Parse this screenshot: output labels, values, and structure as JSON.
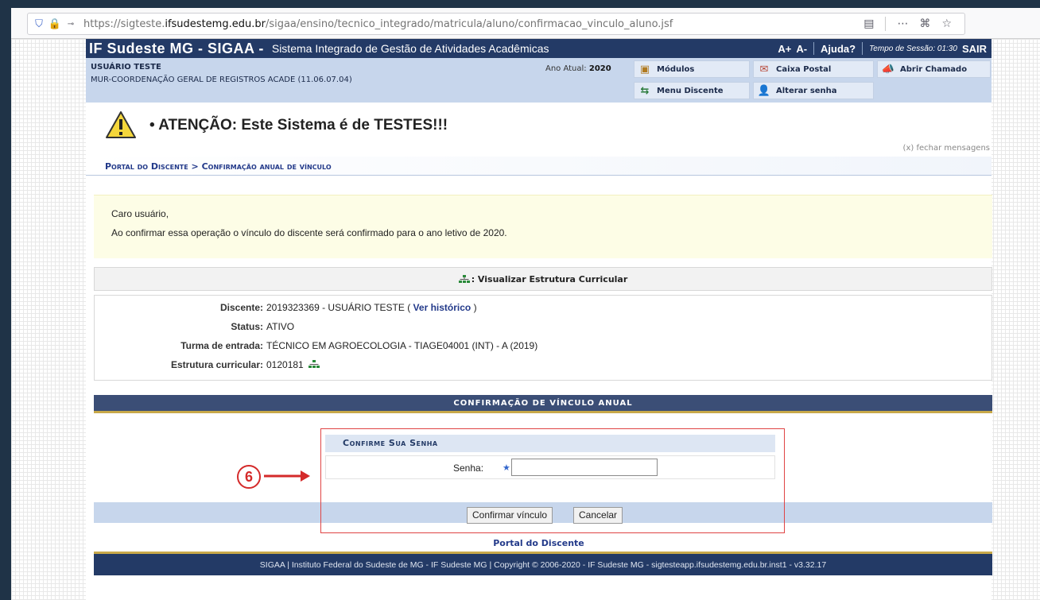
{
  "browser": {
    "url_prefix": "https://sigteste.",
    "url_domain": "ifsudestemg.edu.br",
    "url_path": "/sigaa/ensino/tecnico_integrado/matricula/aluno/confirmacao_vinculo_aluno.jsf"
  },
  "header": {
    "brand": "IF Sudeste MG - SIGAA -",
    "subtitle": "Sistema Integrado de Gestão de Atividades Acadêmicas",
    "font_plus": "A+",
    "font_minus": "A-",
    "help": "Ajuda?",
    "session_time": "Tempo de Sessão: 01:30",
    "logout": "SAIR"
  },
  "user": {
    "name": "USUÁRIO TESTE",
    "unit": "MUR-COORDENAÇÃO GERAL DE REGISTROS ACADE (11.06.07.04)",
    "ano_label": "Ano Atual:",
    "ano_value": "2020"
  },
  "menu": {
    "modulos": "Módulos",
    "caixa_postal": "Caixa Postal",
    "abrir_chamado": "Abrir Chamado",
    "menu_discente": "Menu Discente",
    "alterar_senha": "Alterar senha"
  },
  "message": {
    "text": "• ATENÇÃO: Este Sistema é de TESTES!!!",
    "close": "(x) fechar mensagens"
  },
  "breadcrumb": "Portal do Discente > Confirmação anual de vínculo",
  "notice": {
    "greeting": "Caro usuário,",
    "body": "Ao confirmar essa operação o vínculo do discente será confirmado para o ano letivo de 2020."
  },
  "estrutura_link": ": Visualizar Estrutura Curricular",
  "student": {
    "discente_label": "Discente:",
    "discente_value": "2019323369 - USUÁRIO TESTE (",
    "historico_link": "Ver histórico",
    "historico_close": ")",
    "status_label": "Status:",
    "status_value": "ATIVO",
    "turma_label": "Turma de entrada:",
    "turma_value": "TÉCNICO EM AGROECOLOGIA - TIAGE04001 (INT) - A (2019)",
    "estrutura_label": "Estrutura curricular:",
    "estrutura_value": "0120181"
  },
  "section_title": "CONFIRMAÇÃO DE VÍNCULO ANUAL",
  "password_form": {
    "title": "Confirme Sua Senha",
    "label": "Senha:",
    "required_mark": "★",
    "value": "",
    "confirm_button": "Confirmar vínculo",
    "cancel_button": "Cancelar"
  },
  "annotation_number": "6",
  "footer": {
    "portal_link": "Portal do Discente",
    "copyright": "SIGAA | Instituto Federal do Sudeste de MG - IF Sudeste MG | Copyright © 2006-2020 - IF Sudeste MG - sigtesteapp.ifsudestemg.edu.br.inst1 - v3.32.17"
  },
  "colors": {
    "header_blue": "#233a66",
    "info_blue": "#c7d6ec",
    "gold": "#c8a94a",
    "annotation_red": "#d42a2a"
  }
}
